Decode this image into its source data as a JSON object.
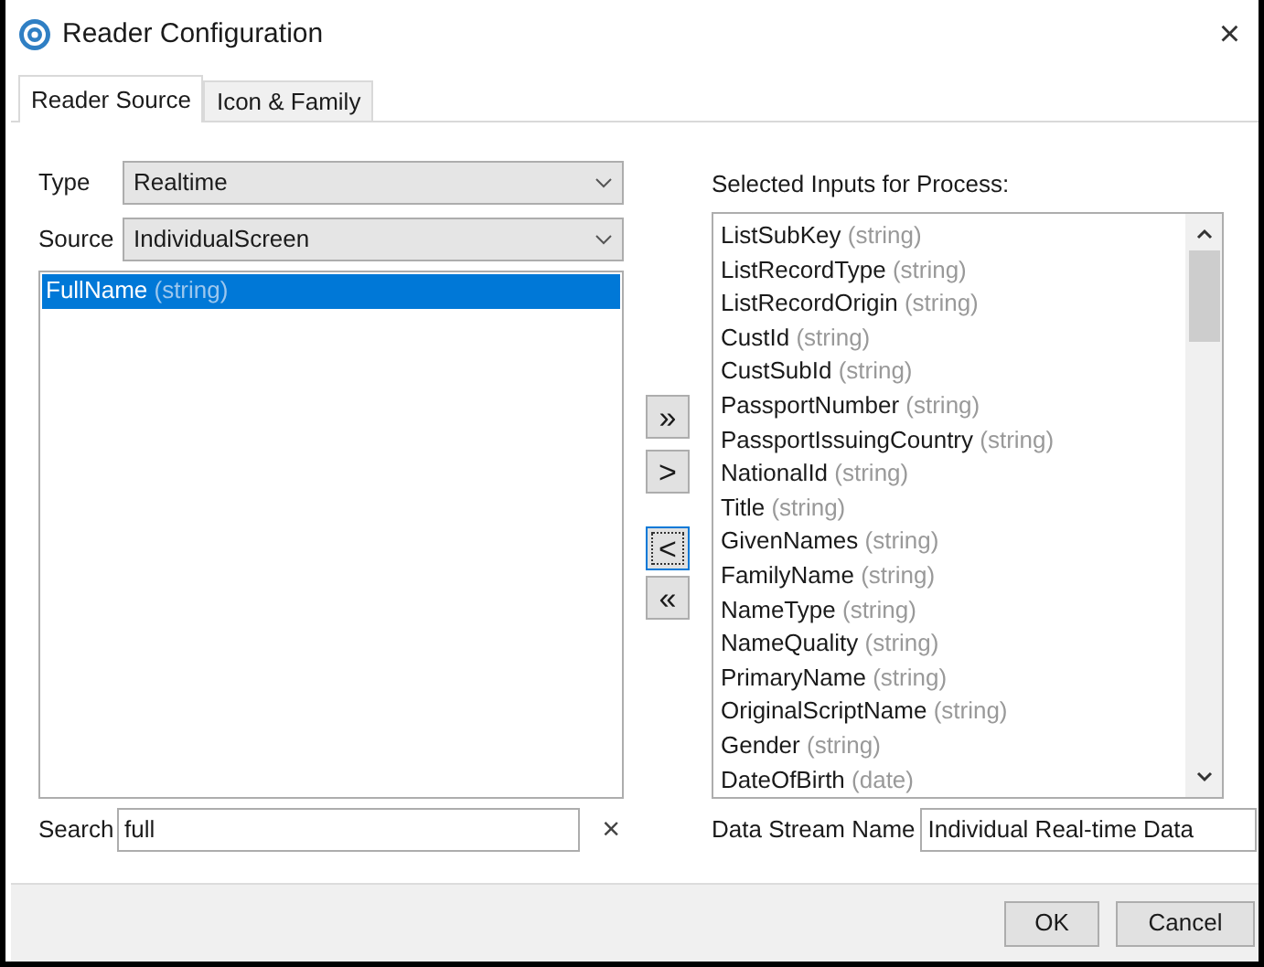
{
  "window": {
    "title": "Reader Configuration",
    "close": "×"
  },
  "tabs": [
    {
      "label": "Reader Source",
      "selected": true
    },
    {
      "label": "Icon & Family",
      "selected": false
    }
  ],
  "type_field": {
    "label": "Type",
    "value": "Realtime"
  },
  "source_field": {
    "label": "Source",
    "value": "IndividualScreen"
  },
  "available_inputs": [
    {
      "name": "FullName",
      "type": "(string)",
      "selected": true
    }
  ],
  "search": {
    "label": "Search",
    "value": "full",
    "clear": "×"
  },
  "transfer_buttons": [
    {
      "label": "»",
      "focused": false
    },
    {
      "label": ">",
      "focused": false
    },
    {
      "label": "<",
      "focused": true
    },
    {
      "label": "«",
      "focused": false
    }
  ],
  "selected_inputs": {
    "label": "Selected Inputs for Process:",
    "items": [
      {
        "name": "ListSubKey",
        "type": "(string)",
        "selected": false
      },
      {
        "name": "ListRecordType",
        "type": "(string)",
        "selected": false
      },
      {
        "name": "ListRecordOrigin",
        "type": "(string)",
        "selected": false
      },
      {
        "name": "CustId",
        "type": "(string)",
        "selected": false
      },
      {
        "name": "CustSubId",
        "type": "(string)",
        "selected": false
      },
      {
        "name": "PassportNumber",
        "type": "(string)",
        "selected": false
      },
      {
        "name": "PassportIssuingCountry",
        "type": "(string)",
        "selected": false
      },
      {
        "name": "NationalId",
        "type": "(string)",
        "selected": false
      },
      {
        "name": "Title",
        "type": "(string)",
        "selected": false
      },
      {
        "name": "GivenNames",
        "type": "(string)",
        "selected": false
      },
      {
        "name": "FamilyName",
        "type": "(string)",
        "selected": false
      },
      {
        "name": "NameType",
        "type": "(string)",
        "selected": false
      },
      {
        "name": "NameQuality",
        "type": "(string)",
        "selected": false
      },
      {
        "name": "PrimaryName",
        "type": "(string)",
        "selected": false
      },
      {
        "name": "OriginalScriptName",
        "type": "(string)",
        "selected": false
      },
      {
        "name": "Gender",
        "type": "(string)",
        "selected": false
      },
      {
        "name": "DateOfBirth",
        "type": "(date)",
        "selected": false
      }
    ]
  },
  "data_stream_name": {
    "label": "Data Stream Name",
    "value": "Individual Real-time Data"
  },
  "buttons": [
    {
      "label": "OK"
    },
    {
      "label": "Cancel"
    }
  ]
}
